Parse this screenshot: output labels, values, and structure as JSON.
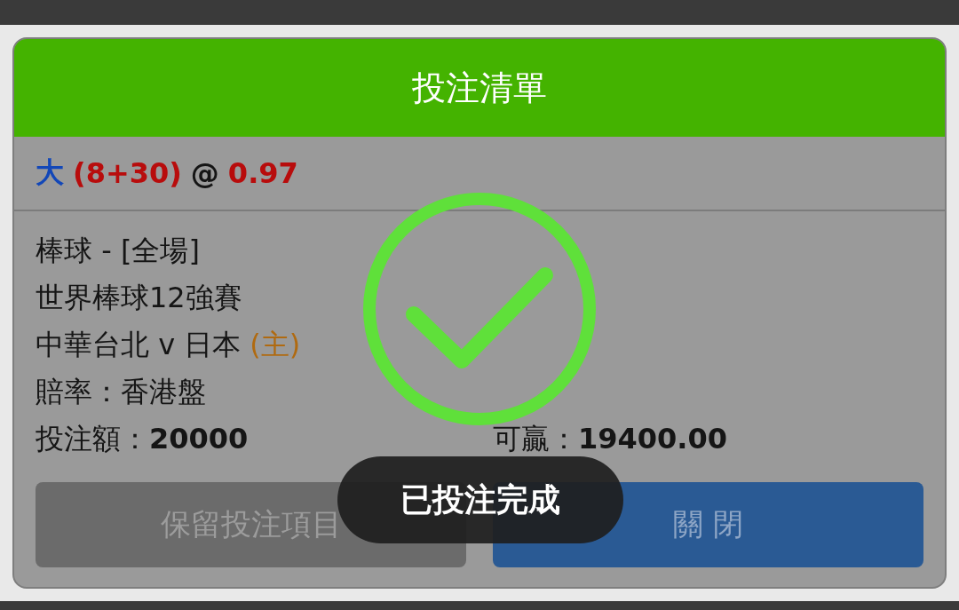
{
  "header": {
    "title": "投注清單"
  },
  "selection": {
    "pick": "大",
    "line": "(8+30)",
    "at": "@",
    "odds": "0.97"
  },
  "details": [
    {
      "text": "棒球 - [全場]"
    },
    {
      "text": "世界棒球12強賽"
    },
    {
      "text": "中華台北 v 日本",
      "tag": "(主)"
    },
    {
      "text": "賠率：香港盤"
    }
  ],
  "amounts": [
    {
      "text": "投注額：**20000**"
    },
    {
      "text": "可贏：**19400.00**"
    }
  ],
  "buttons": [
    {
      "label": "保留投注項目",
      "kind": "secondary"
    },
    {
      "label": "關 閉",
      "kind": "primary"
    }
  ],
  "toast": {
    "text": "已投注完成"
  }
}
